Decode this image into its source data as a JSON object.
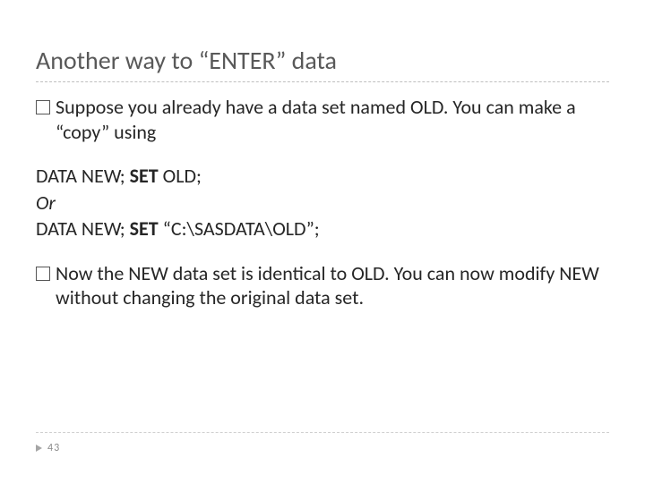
{
  "title": "Another way to “ENTER” data",
  "bullets": {
    "first": "Suppose you already have a data set named OLD. You can make a “copy” using",
    "second": "Now the NEW data set is identical to OLD. You can now modify NEW without changing the original data set."
  },
  "code": {
    "line1_pre": "DATA NEW; ",
    "line1_set": "SET",
    "line1_post": " OLD;",
    "line2": "Or",
    "line3_pre": "DATA NEW; ",
    "line3_set": "SET",
    "line3_post": " “C:\\SASDATA\\OLD”;"
  },
  "page_number": "43"
}
